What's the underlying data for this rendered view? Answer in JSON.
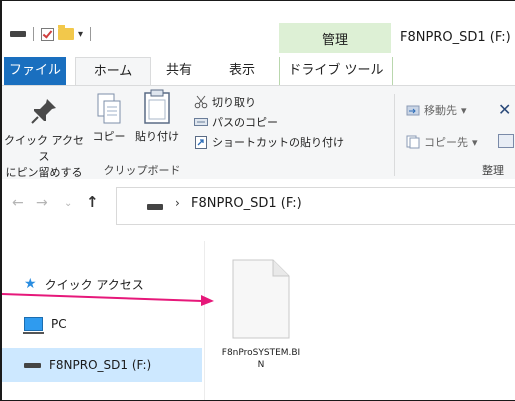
{
  "titlebar": {
    "manage_label": "管理",
    "window_title": "F8NPRO_SD1 (F:)"
  },
  "tabs": {
    "file": "ファイル",
    "home": "ホーム",
    "share": "共有",
    "view": "表示",
    "drive_tools": "ドライブ ツール"
  },
  "ribbon": {
    "pin_label_1": "クイック アクセス",
    "pin_label_2": "にピン留めする",
    "copy_label": "コピー",
    "paste_label": "貼り付け",
    "cut_label": "切り取り",
    "copy_path_label": "パスのコピー",
    "paste_shortcut_label": "ショートカットの貼り付け",
    "clipboard_group": "クリップボード",
    "move_to_label": "移動先",
    "copy_to_label": "コピー先",
    "organize_group": "整理"
  },
  "address": {
    "path": "F8NPRO_SD1 (F:)"
  },
  "nav": {
    "quick_access": "クイック アクセス",
    "pc": "PC",
    "drive": "F8NPRO_SD1 (F:)"
  },
  "content": {
    "file_name": "F8nProSYSTEM.BIN"
  },
  "colors": {
    "file_tab": "#1a6fbf",
    "manage_tab": "#ddf0d5",
    "selected_nav": "#cde8ff",
    "annotation_arrow": "#e6187a"
  }
}
